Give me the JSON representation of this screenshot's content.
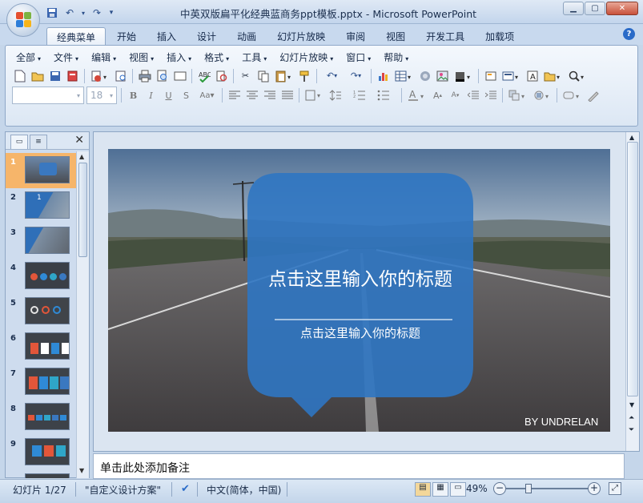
{
  "window": {
    "title": "中英双版扁平化经典蓝商务ppt模板.pptx - Microsoft PowerPoint",
    "controls": [
      "minimize",
      "maximize",
      "close"
    ]
  },
  "ribbon": {
    "tabs": [
      "经典菜单",
      "开始",
      "插入",
      "设计",
      "动画",
      "幻灯片放映",
      "审阅",
      "视图",
      "开发工具",
      "加载项"
    ],
    "active_tab": "经典菜单",
    "menus": [
      "全部",
      "文件",
      "编辑",
      "视图",
      "插入",
      "格式",
      "工具",
      "幻灯片放映",
      "窗口",
      "帮助"
    ],
    "font_size": "18"
  },
  "slides_pane": {
    "thumbnails": [
      {
        "num": "1",
        "selected": true
      },
      {
        "num": "2"
      },
      {
        "num": "3"
      },
      {
        "num": "4"
      },
      {
        "num": "5"
      },
      {
        "num": "6"
      },
      {
        "num": "7"
      },
      {
        "num": "8"
      },
      {
        "num": "9"
      }
    ],
    "thumb2_text": "1"
  },
  "slide": {
    "title": "点击这里输入你的标题",
    "subtitle": "点击这里输入你的标题",
    "credit": "BY UNDRELAN",
    "accent": "#2f75c2"
  },
  "notes": {
    "placeholder": "单击此处添加备注"
  },
  "status": {
    "slide_info": "幻灯片 1/27",
    "theme": "\"自定义设计方案\"",
    "language": "中文(简体，中国)",
    "zoom": "49%"
  }
}
